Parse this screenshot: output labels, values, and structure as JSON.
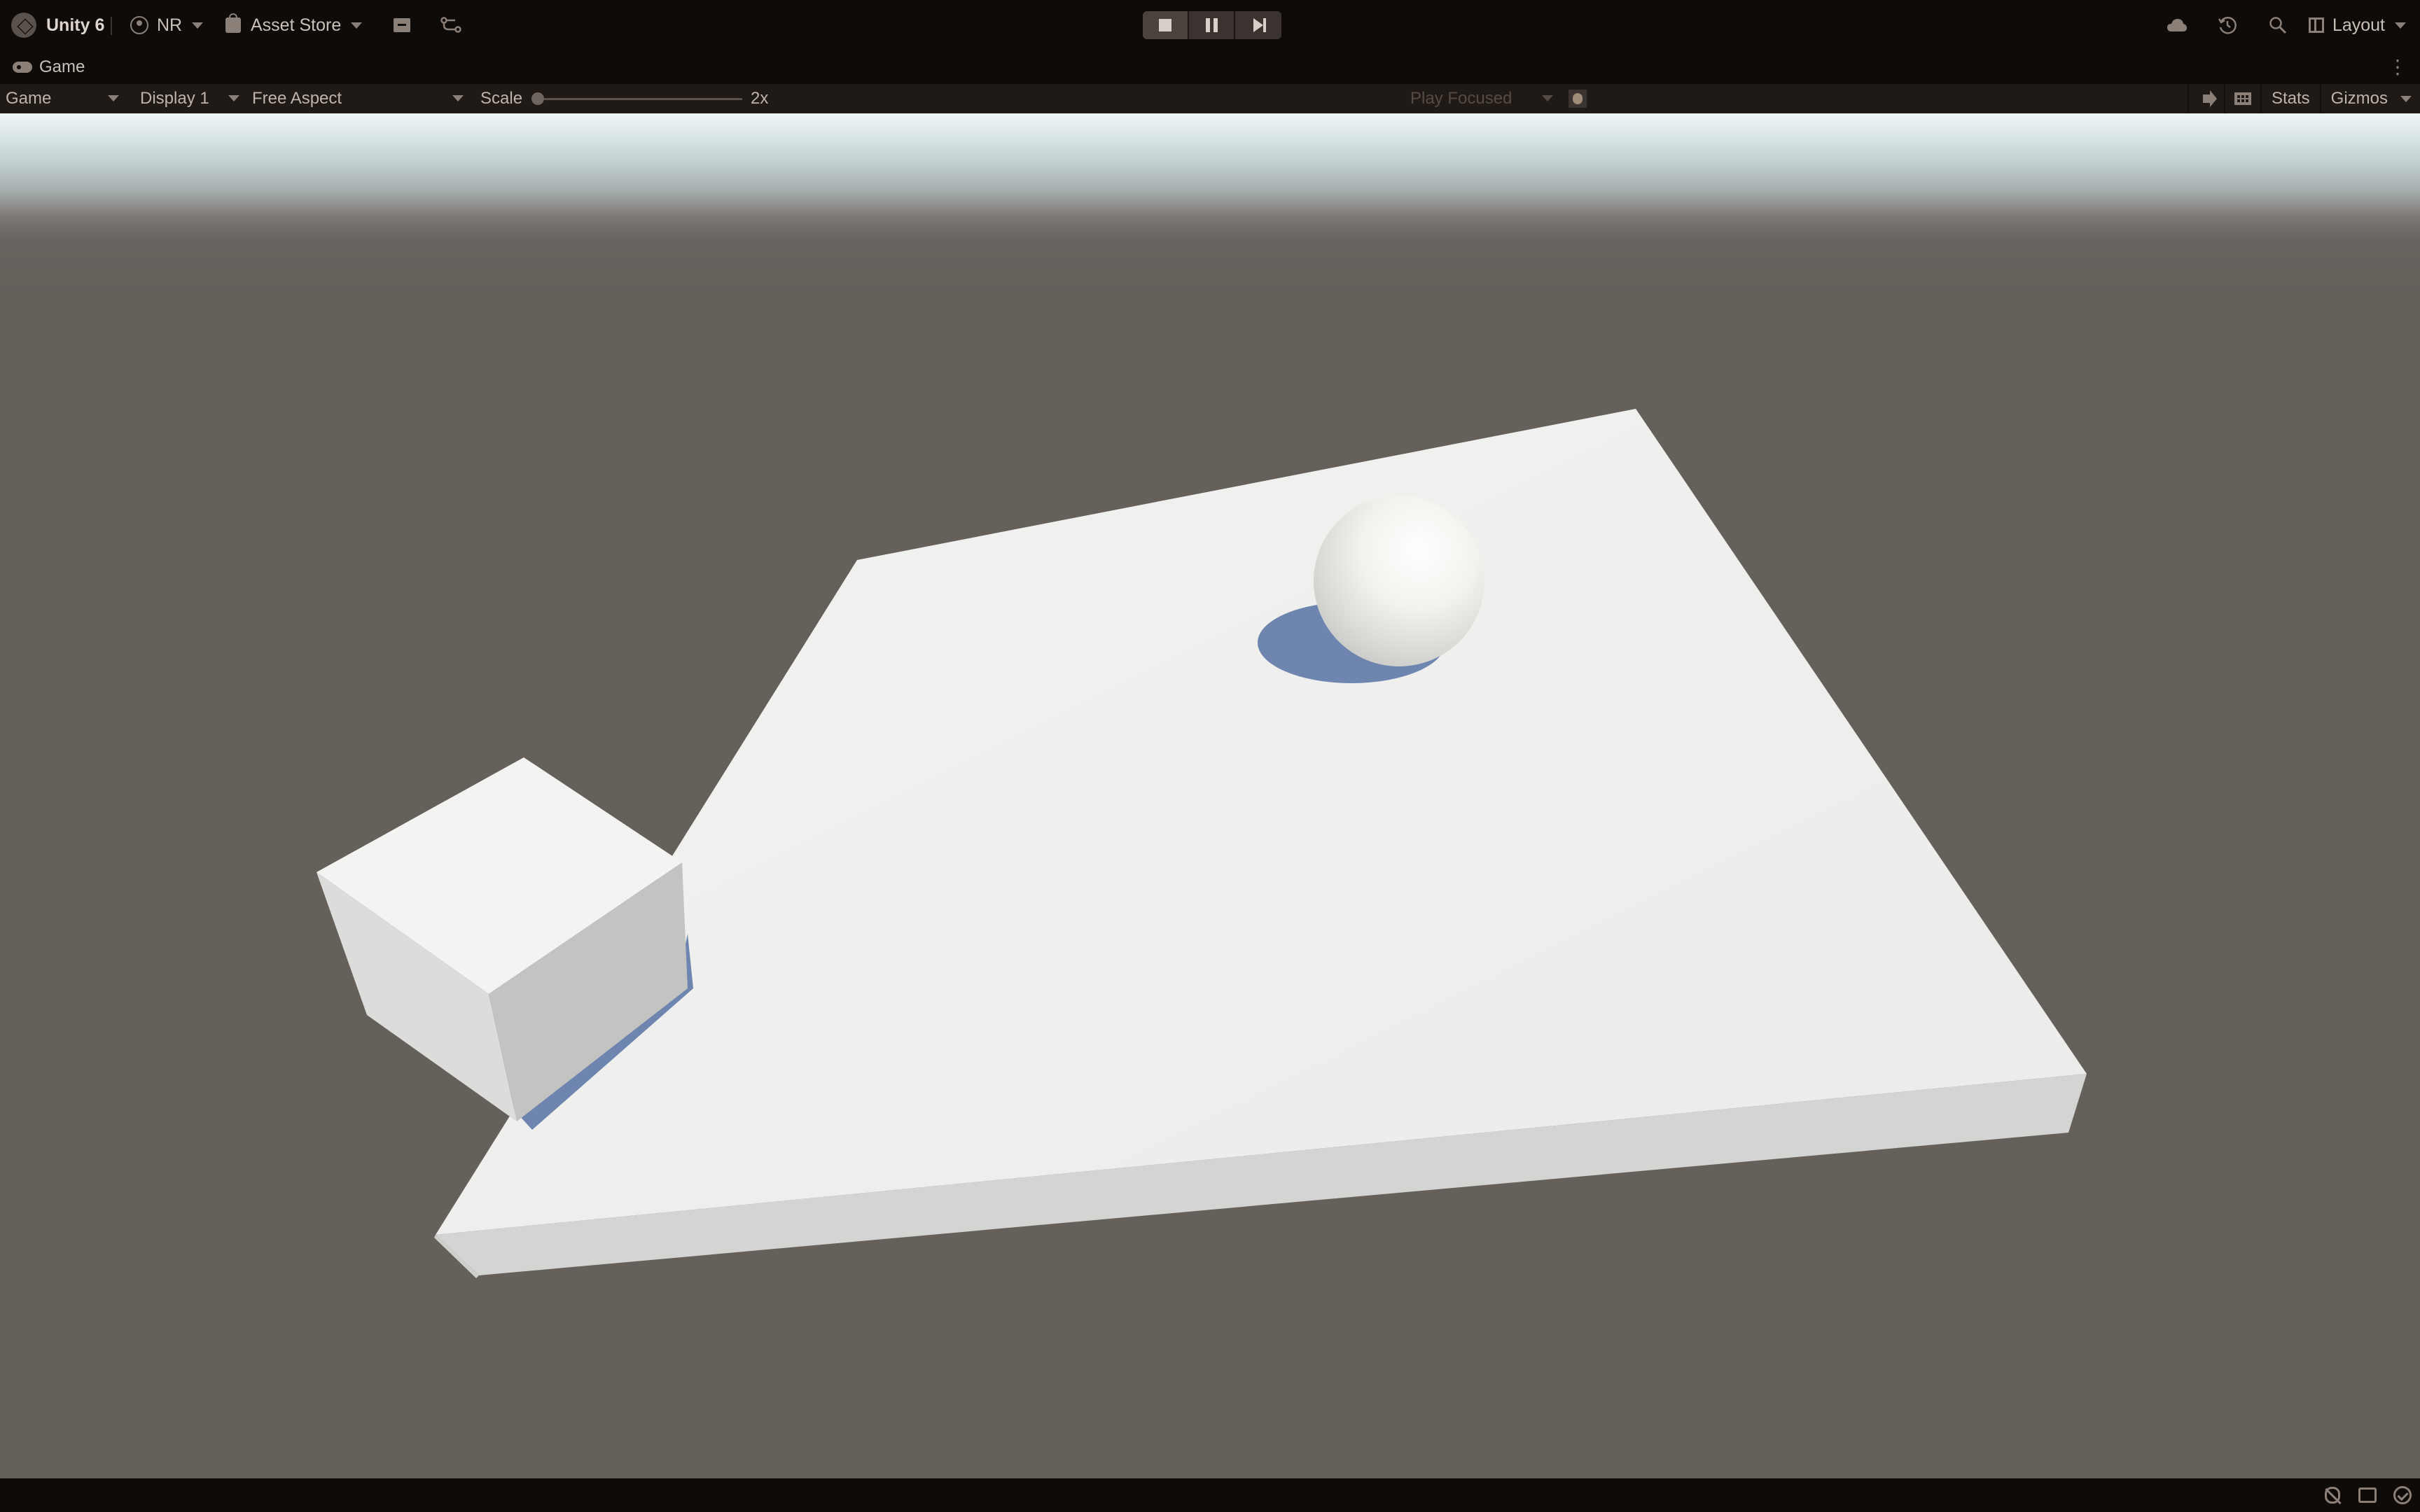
{
  "toolbar": {
    "brand": "Unity 6",
    "account": "NR",
    "asset_store": "Asset Store",
    "layout": "Layout"
  },
  "tab": {
    "label": "Game"
  },
  "game_toolbar": {
    "view_select": "Game",
    "display_select": "Display 1",
    "aspect_select": "Free Aspect",
    "scale_label": "Scale",
    "scale_value": "2x",
    "scale_level": 0,
    "play_focused": "Play Focused",
    "stats": "Stats",
    "gizmos": "Gizmos"
  },
  "icons": {
    "logo": "unity-logo-icon",
    "account": "user-icon",
    "store": "bag-icon",
    "package": "package-icon",
    "version_control": "branch-icon",
    "stop": "stop-icon",
    "pause": "pause-icon",
    "step": "step-icon",
    "cloud": "cloud-icon",
    "history": "history-icon",
    "search": "search-icon",
    "layout": "layout-icon"
  },
  "colors": {
    "editor_bg": "#0f0b08",
    "toolbar_bg": "#201a16",
    "ground": "#66605b",
    "sky": "#eef7f8",
    "plane": "#eeeeec",
    "shadow": "#6e85b0"
  }
}
